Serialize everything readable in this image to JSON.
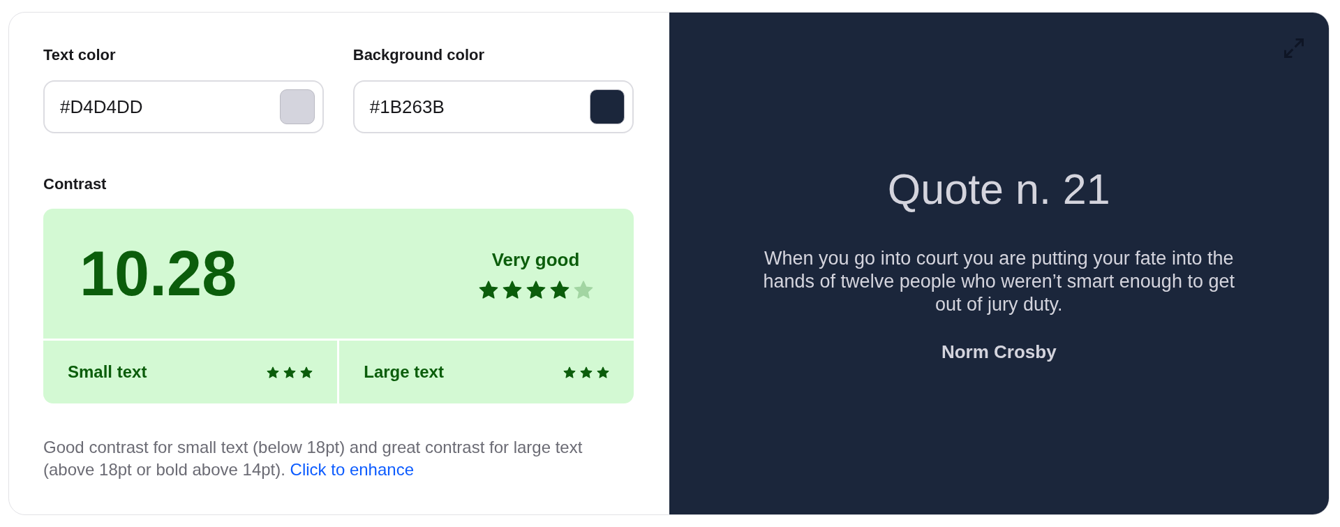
{
  "fields": [
    {
      "label": "Text color",
      "value": "#D4D4DD",
      "color": "#d4d4dd"
    },
    {
      "label": "Background color",
      "value": "#1B263B",
      "color": "#1b263b"
    }
  ],
  "contrast": {
    "label": "Contrast",
    "ratio": "10.28",
    "rating": "Very good",
    "stars": 4,
    "sizes": [
      {
        "label": "Small text",
        "stars": 3
      },
      {
        "label": "Large text",
        "stars": 3
      }
    ],
    "note": "Good contrast for small text (below 18pt) and great contrast for large text (above 18pt or bold above 14pt).",
    "link": "Click to enhance"
  },
  "preview": {
    "title": "Quote n. 21",
    "quote": "When you go into court you are putting your fate into the hands of twelve people who weren’t smart enough to get out of jury duty.",
    "author": "Norm Crosby"
  }
}
